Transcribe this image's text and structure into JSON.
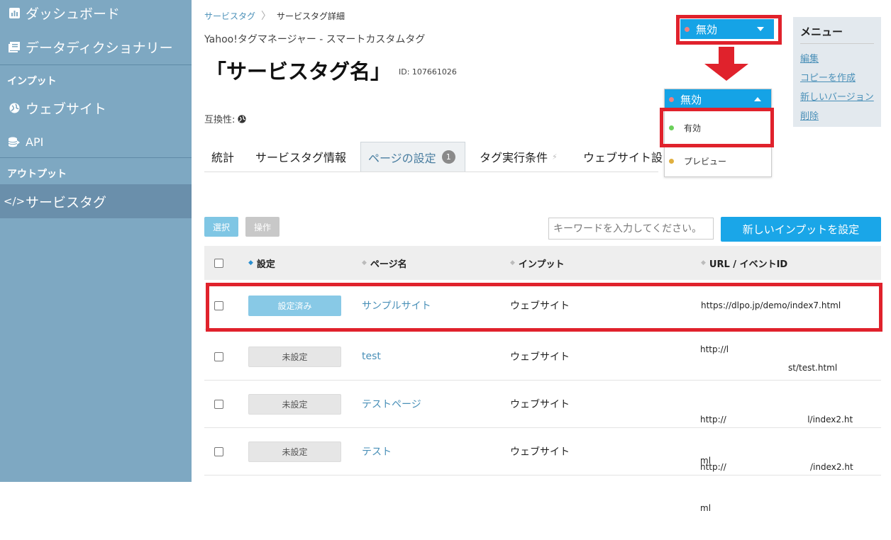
{
  "sidebar": {
    "dashboard": "ダッシュボード",
    "data_dictionary": "データディクショナリー",
    "input_heading": "インプット",
    "website": "ウェブサイト",
    "api": "API",
    "output_heading": "アウトプット",
    "service_tag": "サービスタグ"
  },
  "breadcrumb": {
    "parent": "サービスタグ",
    "current": "サービスタグ詳細"
  },
  "header": {
    "subtitle": "Yahoo!タグマネージャー - スマートカスタムタグ",
    "title": "「サービスタグ名」",
    "id_text": "ID: 107661026",
    "compat_label": "互換性:"
  },
  "status_select": {
    "value": "無効",
    "color": "#f08080"
  },
  "status_dropdown": {
    "value": "無効",
    "options": [
      {
        "label": "有効",
        "color": "#6bd05a"
      },
      {
        "label": "プレビュー",
        "color": "#e0b040"
      }
    ]
  },
  "menu": {
    "title": "メニュー",
    "items": [
      "編集",
      "コピーを作成",
      "新しいバージョン",
      "削除"
    ]
  },
  "tabs": [
    {
      "label": "統計"
    },
    {
      "label": "サービスタグ情報"
    },
    {
      "label": "ページの設定",
      "badge": "1"
    },
    {
      "label": "タグ実行条件"
    },
    {
      "label": "ウェブサイト設"
    }
  ],
  "toolbar": {
    "select_label": "選択",
    "action_label": "操作",
    "search_placeholder": "キーワードを入力してください。",
    "new_input_label": "新しいインプットを設定"
  },
  "table": {
    "headers": [
      "設定",
      "ページ名",
      "インプット",
      "URL / イベントID"
    ],
    "rows": [
      {
        "status": "設定済み",
        "page": "サンプルサイト",
        "input": "ウェブサイト",
        "url1": "https://dlpo.jp/demo/index7.html",
        "url2": ""
      },
      {
        "status": "未設定",
        "page": "test",
        "input": "ウェブサイト",
        "url1": "http://l",
        "url2": "st/test.html"
      },
      {
        "status": "未設定",
        "page": "テストページ",
        "input": "ウェブサイト",
        "url1": "http://                              l/index2.ht",
        "url2": "ml"
      },
      {
        "status": "未設定",
        "page": "テスト",
        "input": "ウェブサイト",
        "url1": "http://                               /index2.ht",
        "url2": "ml"
      }
    ]
  }
}
